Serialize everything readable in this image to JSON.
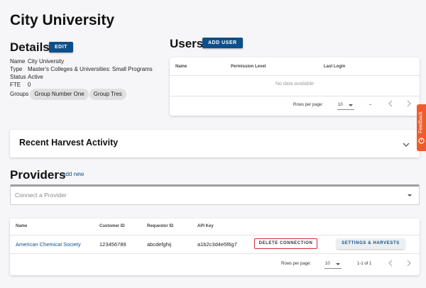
{
  "page": {
    "title": "City University"
  },
  "details": {
    "title": "Details",
    "edit_label": "EDIT",
    "rows": [
      {
        "key": "Name",
        "value": "City University"
      },
      {
        "key": "Type",
        "value": "Master's Colleges & Universities: Small Programs"
      },
      {
        "key": "Status",
        "value": "Active"
      },
      {
        "key": "FTE",
        "value": "0"
      }
    ],
    "groups_label": "Groups",
    "groups": [
      "Group Number One",
      "Group Tres"
    ]
  },
  "users": {
    "title": "Users",
    "add_label": "ADD USER",
    "columns": [
      "Name",
      "Permission Level",
      "Last Login"
    ],
    "empty_text": "No data available",
    "rows_per_page_label": "Rows per page:",
    "rows_per_page_value": "10",
    "range_text": "–"
  },
  "harvest": {
    "title": "Recent Harvest Activity"
  },
  "providers": {
    "title": "Providers",
    "add_new_label": "add new",
    "select_placeholder": "Connect a Provider",
    "columns": [
      "Name",
      "Customer ID",
      "Requestor ID",
      "API Key"
    ],
    "rows": [
      {
        "name": "American Chemical Society",
        "customer_id": "123456789",
        "requestor_id": "abcdefghij",
        "api_key": "a1b2c3d4e5f6g7"
      }
    ],
    "delete_label": "DELETE CONNECTION",
    "settings_label": "SETTINGS & HARVESTS",
    "rows_per_page_label": "Rows per page:",
    "rows_per_page_value": "10",
    "range_text": "1-1 of 1"
  },
  "feedback": {
    "label": "Feedback"
  },
  "colors": {
    "primary": "#0d4f8b",
    "danger": "#d32f2f",
    "feedback": "#f15a2b"
  },
  "icons": [
    "chevron-down-icon",
    "chevron-left-icon",
    "chevron-right-icon",
    "dropdown-arrow-icon",
    "feedback-icon"
  ]
}
